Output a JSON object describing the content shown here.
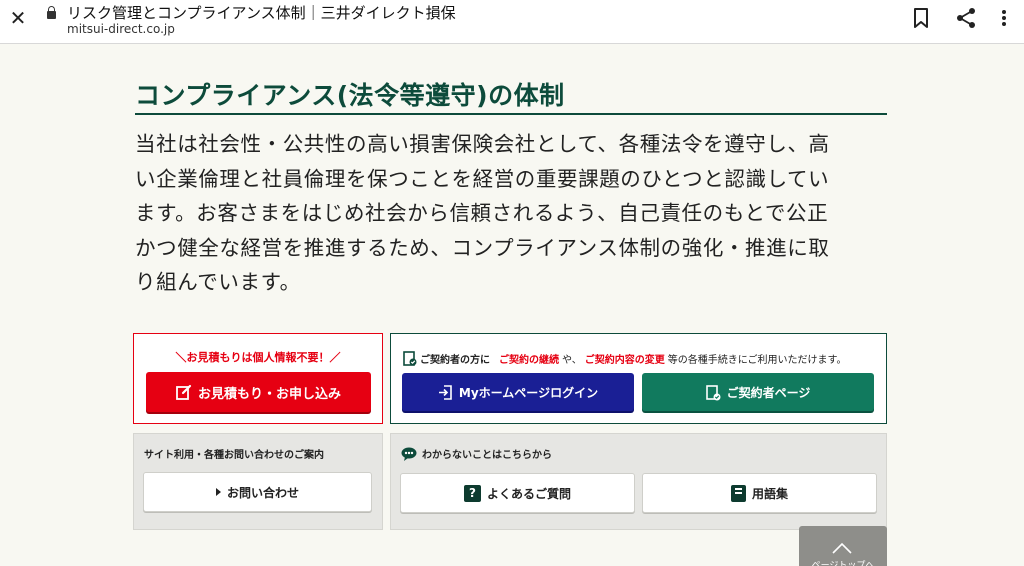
{
  "browser": {
    "page_title": "リスク管理とコンプライアンス体制｜三井ダイレクト損保",
    "url": "mitsui-direct.co.jp"
  },
  "content": {
    "section_title": "コンプライアンス(法令等遵守)の体制",
    "paragraph_lines": [
      "当社は社会性・公共性の高い損害保険会社として、各種法令を遵守し、高",
      "い企業倫理と社員倫理を保つことを経営の重要課題のひとつと認識してい",
      "ます。お客さまをはじめ社会から信頼されるよう、自己責任のもとで公正",
      "かつ健全な経営を推進するため、コンプライアンス体制の強化・推進に取",
      "り組んでいます。"
    ]
  },
  "estimate": {
    "note": "＼お見積もりは個人情報不要！／",
    "button_label": "お見積もり・お申し込み"
  },
  "contract": {
    "prefix": "ご契約者の方に",
    "highlight1": "ご契約の継続",
    "mid": "や、",
    "highlight2": "ご契約内容の変更",
    "suffix": "等の各種手続きにご利用いただけます。",
    "mypage_button": "Myホームページログイン",
    "contractor_button": "ご契約者ページ"
  },
  "site_info": {
    "heading": "サイト利用・各種お問い合わせのご案内",
    "inquiry_button": "お問い合わせ"
  },
  "help": {
    "heading": "わからないことはこちらから",
    "faq_button": "よくあるご質問",
    "glossary_button": "用語集"
  },
  "pagetop": {
    "label": "ページトップへ"
  },
  "colors": {
    "brand_green": "#0d4b3b",
    "red": "#e60012",
    "navy": "#1a1f95",
    "teal": "#117a5e"
  }
}
